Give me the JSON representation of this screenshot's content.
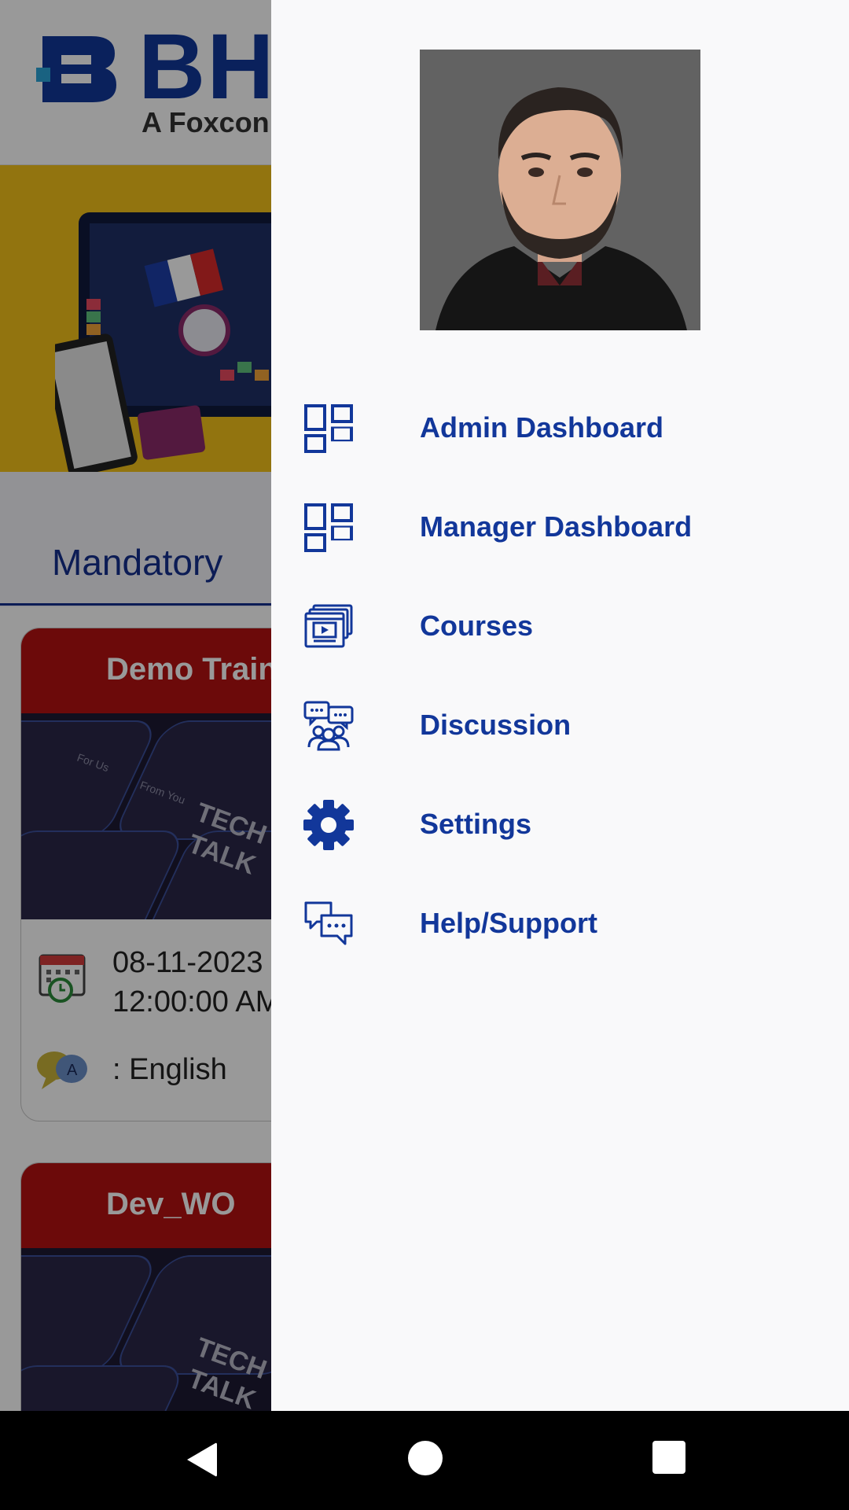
{
  "app": {
    "logo_text": "BH",
    "logo_subtitle": "A Foxconn",
    "tabs": [
      {
        "label": "Mandatory"
      }
    ],
    "courses": [
      {
        "title": "Demo Train",
        "date": "08-11-2023",
        "time": "12:00:00 AM",
        "language": ": English"
      },
      {
        "title": "Dev_WO"
      }
    ],
    "card_image_words": [
      "TECH",
      "TALK",
      "For Us",
      "From You"
    ]
  },
  "drawer": {
    "menu": [
      {
        "label": "Admin Dashboard",
        "icon": "dashboard-icon"
      },
      {
        "label": "Manager Dashboard",
        "icon": "dashboard-icon"
      },
      {
        "label": "Courses",
        "icon": "video-course-icon"
      },
      {
        "label": "Discussion",
        "icon": "group-chat-icon"
      },
      {
        "label": "Settings",
        "icon": "gear-icon"
      },
      {
        "label": "Help/Support",
        "icon": "chat-bubbles-icon"
      }
    ]
  },
  "colors": {
    "brand_blue": "#12379a",
    "card_header_red": "#b51212",
    "banner_yellow": "#f4c21a",
    "drawer_bg": "#f9f9fa"
  }
}
